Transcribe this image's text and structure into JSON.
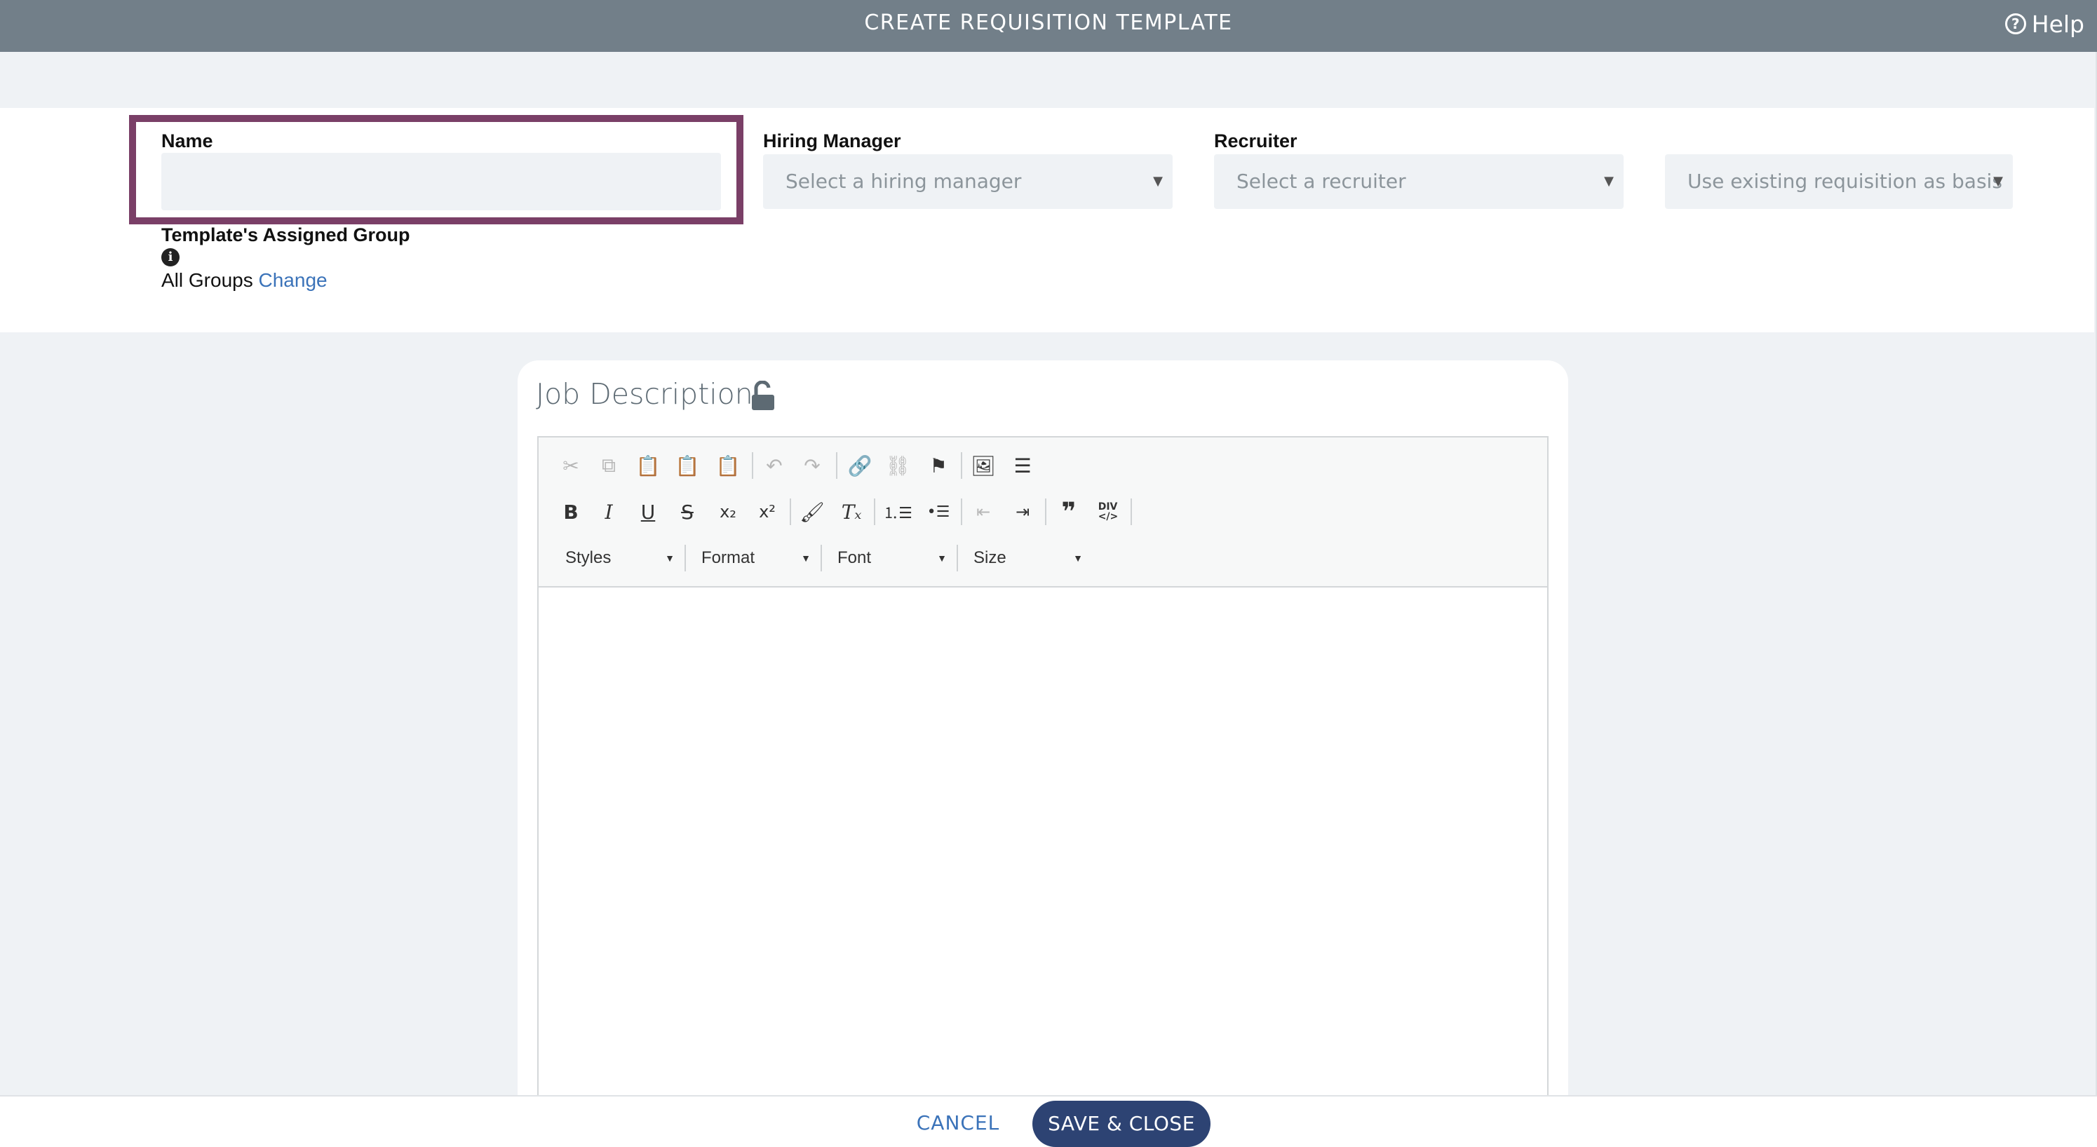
{
  "window": {
    "title": "CREATE REQUISITION TEMPLATE",
    "help_label": "Help",
    "help_icon": "question-circle-icon"
  },
  "form": {
    "name_label": "Name",
    "name_value": "",
    "hiring_manager_label": "Hiring Manager",
    "hiring_manager_placeholder": "Select a hiring manager",
    "recruiter_label": "Recruiter",
    "recruiter_placeholder": "Select a recruiter",
    "basis_placeholder": "Use existing requisition as basis",
    "group_label": "Template's Assigned Group",
    "group_value": "All Groups",
    "group_change_link": "Change"
  },
  "editor": {
    "title": "Job Description",
    "lock_icon": "unlock-icon",
    "toolbar_row1": [
      "cut-icon",
      "copy-icon",
      "paste-icon",
      "paste-text-icon",
      "paste-word-icon",
      "undo-icon",
      "redo-icon",
      "link-icon",
      "unlink-icon",
      "anchor-flag-icon",
      "image-icon",
      "horizontal-rule-icon"
    ],
    "toolbar_row2": [
      "bold-icon",
      "italic-icon",
      "underline-icon",
      "strike-icon",
      "subscript-icon",
      "superscript-icon",
      "copy-format-icon",
      "remove-format-icon",
      "numbered-list-icon",
      "bulleted-list-icon",
      "outdent-icon",
      "indent-icon",
      "blockquote-icon",
      "div-container-icon"
    ],
    "combos": {
      "styles": "Styles",
      "format": "Format",
      "font": "Font",
      "size": "Size"
    },
    "content": ""
  },
  "footer": {
    "cancel_label": "CANCEL",
    "save_label": "SAVE & CLOSE"
  },
  "colors": {
    "titlebar": "#727f89",
    "highlight": "#7a3f67",
    "primary": "#2d4373",
    "link": "#3b73b9"
  }
}
